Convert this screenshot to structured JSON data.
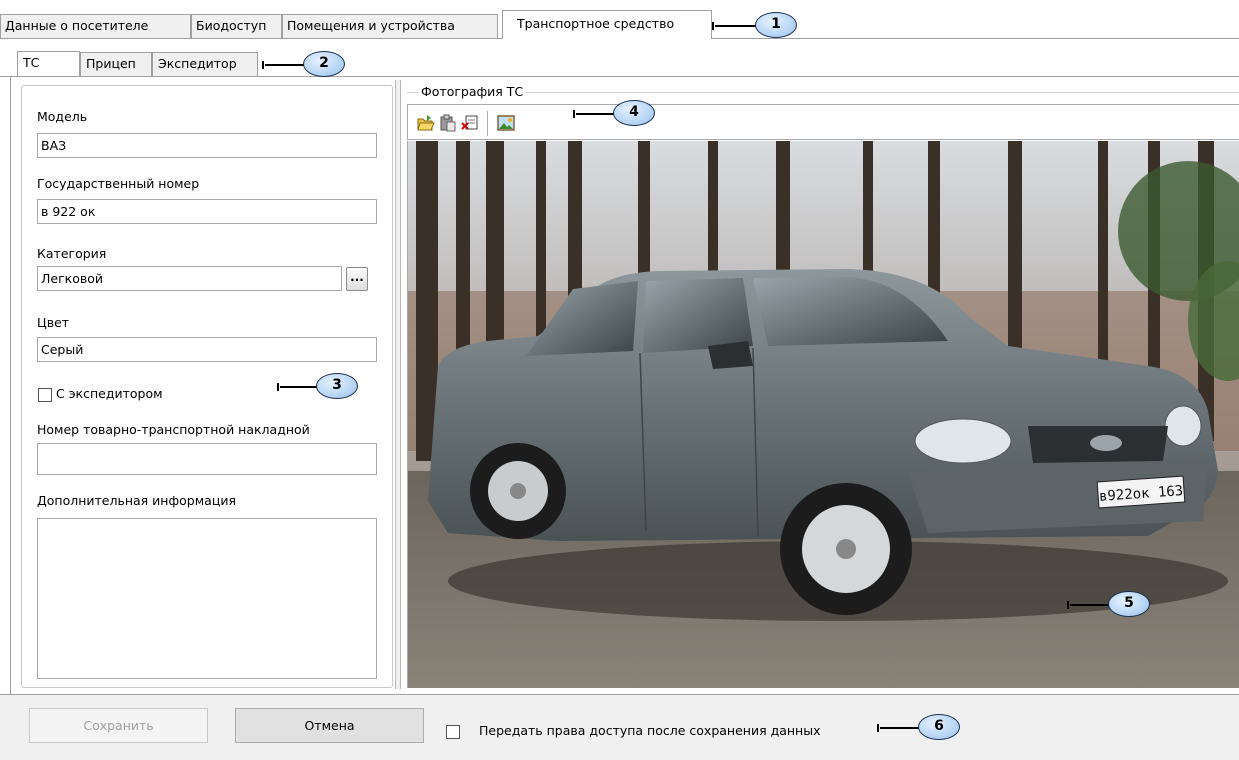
{
  "top_tabs": [
    {
      "label": "Данные о посетителе"
    },
    {
      "label": "Биодоступ"
    },
    {
      "label": "Помещения и устройства"
    },
    {
      "label": "Транспортное средство",
      "active": true
    }
  ],
  "sub_tabs": [
    {
      "label": "ТС",
      "active": true
    },
    {
      "label": "Прицеп"
    },
    {
      "label": "Экспедитор"
    }
  ],
  "form": {
    "model": {
      "label": "Модель",
      "value": "ВАЗ"
    },
    "plate": {
      "label": "Государственный номер",
      "value": "в 922 ок"
    },
    "category": {
      "label": "Категория",
      "value": "Легковой",
      "button_label": "..."
    },
    "color": {
      "label": "Цвет",
      "value": "Серый"
    },
    "with_forwarder": {
      "label": "С экспедитором",
      "checked": false
    },
    "waybill": {
      "label": "Номер товарно-транспортной накладной",
      "value": ""
    },
    "additional": {
      "label": "Дополнительная информация",
      "value": ""
    }
  },
  "photo": {
    "group_label": "Фотография ТС",
    "toolbar_icons": [
      "open-file-icon",
      "paste-icon",
      "delete-photo-icon",
      "photo-view-icon"
    ],
    "license_plate_text": "в922ок 163"
  },
  "bottom": {
    "save_label": "Сохранить",
    "cancel_label": "Отмена",
    "transfer_rights_label": "Передать права доступа после сохранения данных",
    "transfer_rights_checked": false
  },
  "callouts": [
    "1",
    "2",
    "3",
    "4",
    "5",
    "6"
  ],
  "colors": {
    "callout_fill": "#b8d5f5",
    "callout_border": "#1b2f4f",
    "window_bg": "#f0f0f0"
  }
}
